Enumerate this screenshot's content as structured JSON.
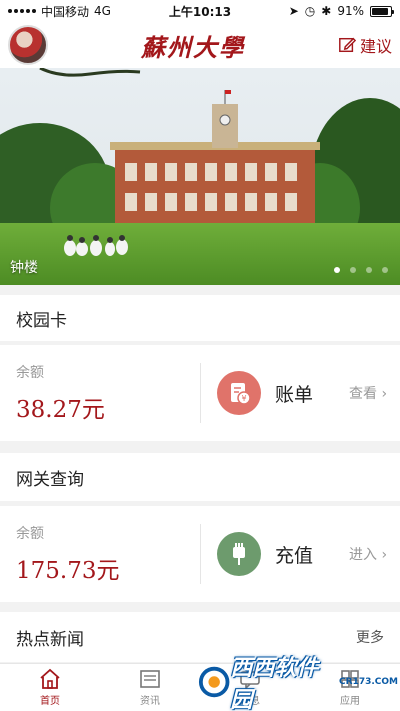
{
  "status": {
    "carrier": "中国移动",
    "network": "4G",
    "time": "上午10:13",
    "battery": "91%",
    "battery_level": 0.91
  },
  "header": {
    "logo": "蘇州大學",
    "suggest_label": "建议"
  },
  "banner": {
    "caption": "钟楼",
    "slide_count": 4,
    "active_slide": 0
  },
  "campus_card": {
    "title": "校园卡",
    "balance_label": "余额",
    "balance": "38.27元",
    "action_label": "账单",
    "action_link": "查看 ›"
  },
  "gateway": {
    "title": "网关查询",
    "balance_label": "余额",
    "balance": "175.73元",
    "action_label": "充值",
    "action_link": "进入 ›"
  },
  "news": {
    "title": "热点新闻",
    "more_label": "更多"
  },
  "tabbar": {
    "tabs": [
      {
        "label": "首页",
        "icon": "home-icon"
      },
      {
        "label": "资讯",
        "icon": "news-icon"
      },
      {
        "label": "消息",
        "icon": "message-icon"
      },
      {
        "label": "应用",
        "icon": "apps-icon"
      }
    ]
  },
  "watermark": {
    "text": "西西软件园",
    "sub": "CR173.COM"
  },
  "colors": {
    "accent": "#a3171b",
    "bill": "#e0736a",
    "recharge": "#6d9b6d"
  }
}
